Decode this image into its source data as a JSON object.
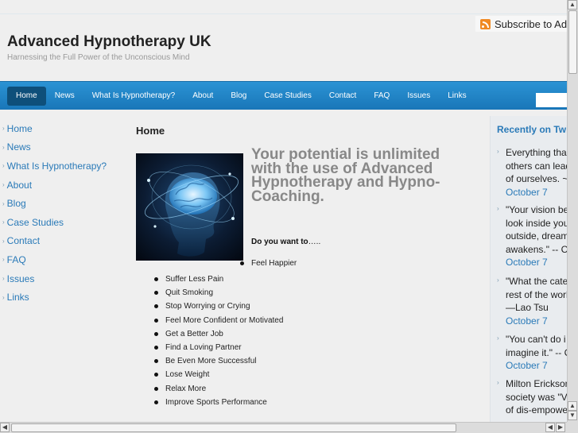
{
  "header": {
    "subscribe_label": "Subscribe to Adv",
    "site_title": "Advanced Hypnotherapy UK",
    "tagline": "Harnessing the Full Power of the Unconscious Mind"
  },
  "nav": {
    "items": [
      {
        "label": "Home"
      },
      {
        "label": "News"
      },
      {
        "label": "What Is Hypnotherapy?"
      },
      {
        "label": "About"
      },
      {
        "label": "Blog"
      },
      {
        "label": "Case Studies"
      },
      {
        "label": "Contact"
      },
      {
        "label": "FAQ"
      },
      {
        "label": "Issues"
      },
      {
        "label": "Links"
      }
    ],
    "active": "Home",
    "search_value": ""
  },
  "sidebar_left": {
    "items": [
      {
        "label": "Home"
      },
      {
        "label": "News"
      },
      {
        "label": "What Is Hypnotherapy?"
      },
      {
        "label": "About"
      },
      {
        "label": "Blog"
      },
      {
        "label": "Case Studies"
      },
      {
        "label": "Contact"
      },
      {
        "label": "FAQ"
      },
      {
        "label": "Issues"
      },
      {
        "label": "Links"
      }
    ]
  },
  "main": {
    "page_heading": "Home",
    "headline": "Your potential is unlimited with the use of Advanced Hypnotherapy and Hypno-Coaching.",
    "prompt_bold": "Do you want to",
    "prompt_rest": "…..",
    "first_bullet": "Feel Happier",
    "bullets": [
      "Suffer Less Pain",
      "Quit Smoking",
      "Stop Worrying or Crying",
      "Feel More Confident or Motivated",
      "Get a Better Job",
      "Find a Loving Partner",
      "Be Even More Successful",
      "Lose Weight",
      "Relax More",
      "Improve Sports Performance"
    ]
  },
  "sidebar_right": {
    "title": "Recently on Twi",
    "tweets": [
      {
        "lines": [
          "Everything tha",
          "others can lead",
          "of ourselves. ~"
        ],
        "date": "October 7"
      },
      {
        "lines": [
          "\"Your vision be",
          "look inside you",
          "outside, dream",
          "awakens.\" -- C"
        ],
        "date": "October 7"
      },
      {
        "lines": [
          "\"What the cate",
          "rest of the worl",
          "—Lao Tsu"
        ],
        "date": "October 7"
      },
      {
        "lines": [
          "\"You can't do i",
          "imagine it.\" -- C"
        ],
        "date": "October 7"
      },
      {
        "lines": [
          "Milton Erickson",
          "society was \"V",
          "of dis-empowe"
        ],
        "date": ""
      }
    ]
  },
  "icons": {
    "rss": "rss-feed-icon",
    "list_chevron": "chevron-right-icon",
    "bullet": "bullet-dot-icon"
  },
  "colors": {
    "nav_bar": "#1f86c8",
    "nav_active": "#0e4f7a",
    "link": "#2a7ab8",
    "headline": "#888888",
    "rss": "#f08a24"
  }
}
